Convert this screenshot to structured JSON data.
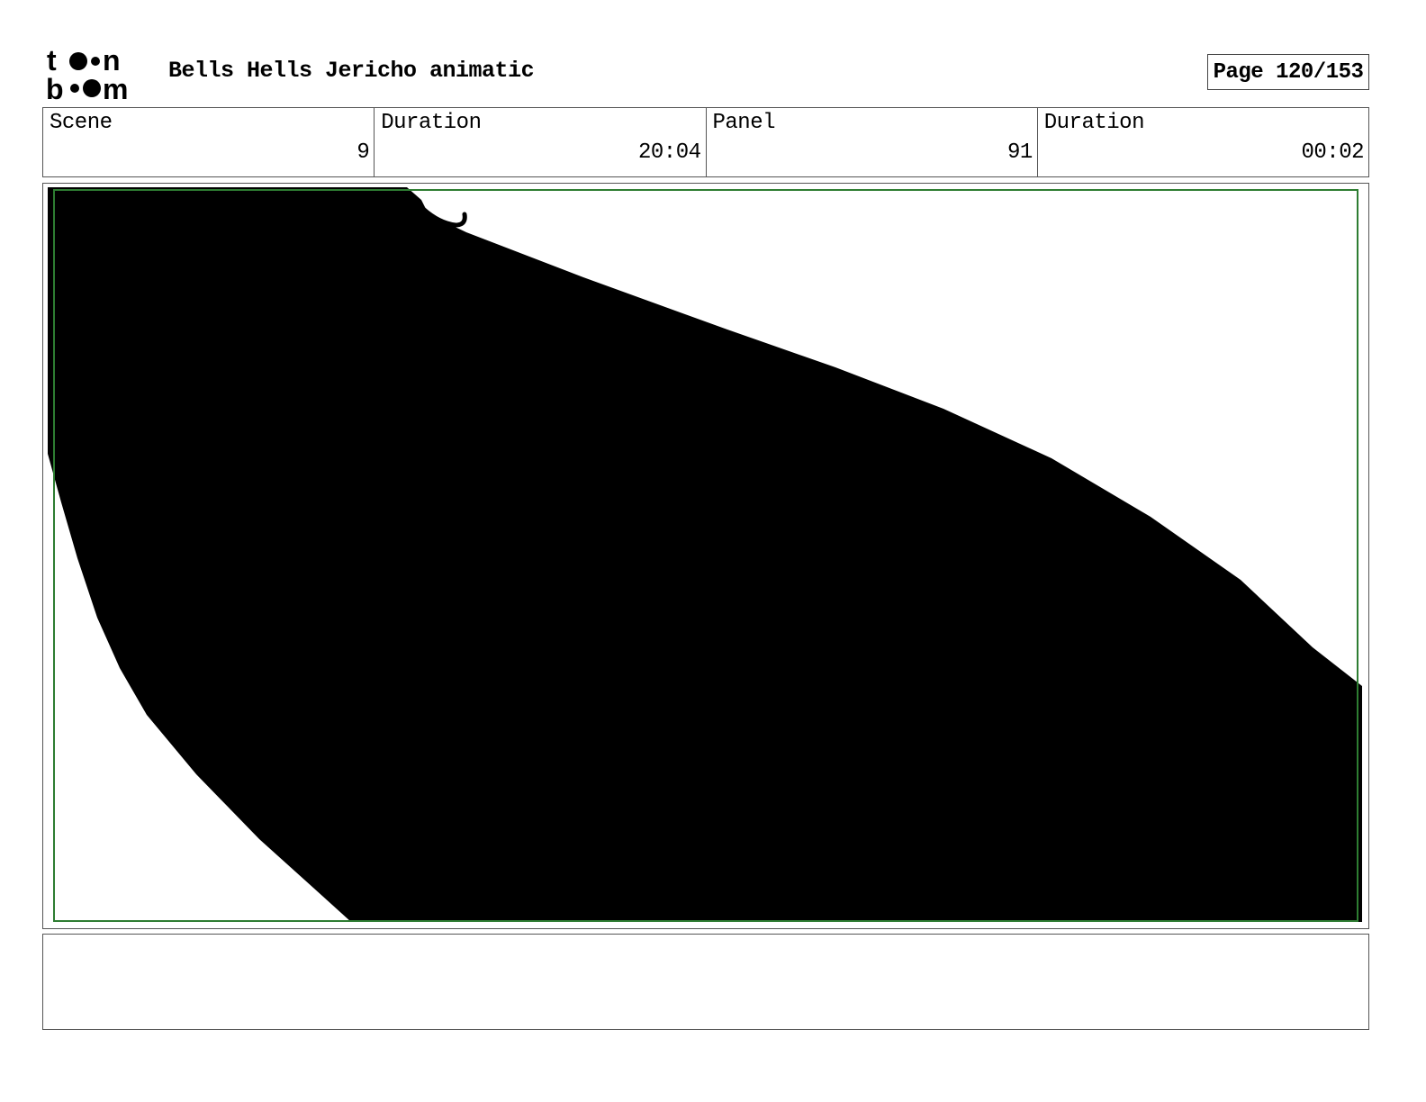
{
  "header": {
    "logo_text": "toon boom",
    "title": "Bells Hells Jericho animatic",
    "page": "Page 120/153"
  },
  "info": [
    {
      "label": "Scene",
      "value": "9"
    },
    {
      "label": "Duration",
      "value": "20:04"
    },
    {
      "label": "Panel",
      "value": "91"
    },
    {
      "label": "Duration",
      "value": "00:02"
    }
  ],
  "panel": {
    "safe_frame_color": "#2e7d32",
    "fill_color": "#000000"
  },
  "notes": {
    "text": ""
  }
}
